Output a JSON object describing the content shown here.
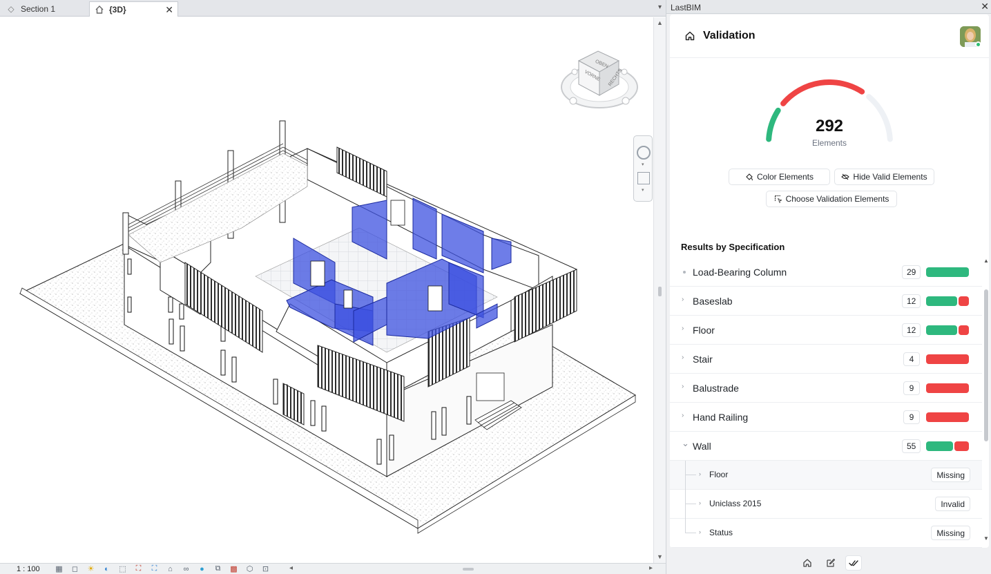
{
  "revit": {
    "tabs": [
      {
        "label": "Section 1",
        "icon": "section-view-icon",
        "active": false
      },
      {
        "label": "{3D}",
        "icon": "home-3d-icon",
        "active": true
      }
    ],
    "viewcube": {
      "top": "OBEN",
      "front": "VORNE",
      "right": "RECHTS"
    },
    "status": {
      "scale": "1 : 100"
    }
  },
  "panel": {
    "window_title": "LastBIM",
    "header": {
      "title": "Validation",
      "icon": "home-icon"
    },
    "gauge": {
      "value": "292",
      "label": "Elements",
      "valid_fraction": 0.18,
      "invalid_fraction": 0.5,
      "colors": {
        "valid": "#2eb87e",
        "invalid": "#ef4444",
        "track": "#eef1f5"
      }
    },
    "buttons": {
      "color": "Color Elements",
      "hide": "Hide Valid Elements",
      "choose": "Choose Validation Elements"
    },
    "results_title": "Results by Specification",
    "results": [
      {
        "label": "Load-Bearing Column",
        "count": "29",
        "valid": 1.0,
        "expandable": false
      },
      {
        "label": "Baseslab",
        "count": "12",
        "valid": 0.75,
        "expandable": true
      },
      {
        "label": "Floor",
        "count": "12",
        "valid": 0.75,
        "expandable": true
      },
      {
        "label": "Stair",
        "count": "4",
        "valid": 0.0,
        "expandable": true
      },
      {
        "label": "Balustrade",
        "count": "9",
        "valid": 0.0,
        "expandable": true
      },
      {
        "label": "Hand Railing",
        "count": "9",
        "valid": 0.0,
        "expandable": true
      },
      {
        "label": "Wall",
        "count": "55",
        "valid": 0.65,
        "expandable": true,
        "expanded": true
      }
    ],
    "wall_properties": [
      {
        "label": "Floor",
        "status": "Missing"
      },
      {
        "label": "Uniclass 2015",
        "status": "Invalid"
      },
      {
        "label": "Status",
        "status": "Missing"
      }
    ],
    "bottom_nav": [
      "home-icon",
      "edit-icon",
      "check-double-icon"
    ]
  }
}
